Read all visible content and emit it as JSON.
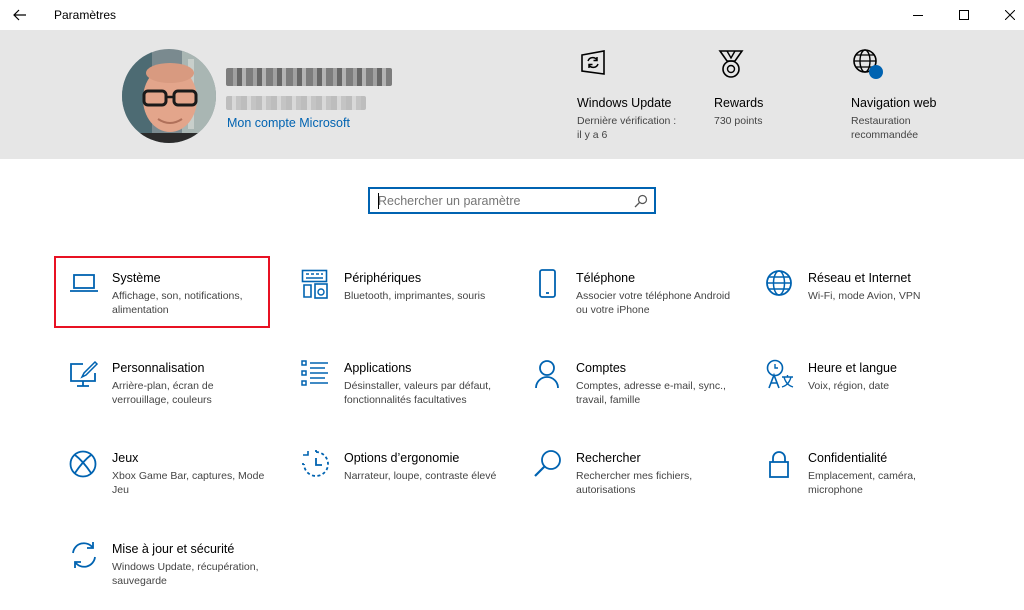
{
  "window": {
    "title": "Paramètres",
    "back_icon": "back-arrow-icon",
    "controls": [
      "minimize-icon",
      "maximize-icon",
      "close-icon"
    ]
  },
  "account": {
    "link_label": "Mon compte Microsoft",
    "name_obscured": true,
    "email_obscured": true
  },
  "quick_links": [
    {
      "title": "Windows Update",
      "subtitle": "Dernière vérification : il y a 6",
      "icon": "windows-update-icon"
    },
    {
      "title": "Rewards",
      "subtitle": "730 points",
      "icon": "rewards-medal-icon"
    },
    {
      "title": "Navigation web",
      "subtitle": "Restauration recommandée",
      "icon": "globe-alert-icon"
    }
  ],
  "search": {
    "placeholder": "Rechercher un paramètre"
  },
  "categories": [
    {
      "title": "Système",
      "subtitle": "Affichage, son, notifications, alimentation",
      "icon": "laptop-icon",
      "highlighted": true
    },
    {
      "title": "Périphériques",
      "subtitle": "Bluetooth, imprimantes, souris",
      "icon": "devices-icon"
    },
    {
      "title": "Téléphone",
      "subtitle": "Associer votre téléphone Android ou votre iPhone",
      "icon": "phone-icon"
    },
    {
      "title": "Réseau et Internet",
      "subtitle": "Wi-Fi, mode Avion, VPN",
      "icon": "globe-icon"
    },
    {
      "title": "Personnalisation",
      "subtitle": "Arrière-plan, écran de verrouillage, couleurs",
      "icon": "personalization-icon"
    },
    {
      "title": "Applications",
      "subtitle": "Désinstaller, valeurs par défaut, fonctionnalités facultatives",
      "icon": "apps-list-icon"
    },
    {
      "title": "Comptes",
      "subtitle": "Comptes, adresse e-mail, sync., travail, famille",
      "icon": "person-icon"
    },
    {
      "title": "Heure et langue",
      "subtitle": "Voix, région, date",
      "icon": "time-language-icon"
    },
    {
      "title": "Jeux",
      "subtitle": "Xbox Game Bar, captures, Mode Jeu",
      "icon": "xbox-icon"
    },
    {
      "title": "Options d’ergonomie",
      "subtitle": "Narrateur, loupe, contraste élevé",
      "icon": "ease-of-access-icon"
    },
    {
      "title": "Rechercher",
      "subtitle": "Rechercher mes fichiers, autorisations",
      "icon": "search-icon"
    },
    {
      "title": "Confidentialité",
      "subtitle": "Emplacement, caméra, microphone",
      "icon": "lock-icon"
    },
    {
      "title": "Mise à jour et sécurité",
      "subtitle": "Windows Update, récupération, sauvegarde",
      "icon": "update-sync-icon"
    }
  ],
  "colors": {
    "accent": "#0063b1",
    "highlight_border": "#e81123",
    "header_bg": "#e6e6e6"
  }
}
